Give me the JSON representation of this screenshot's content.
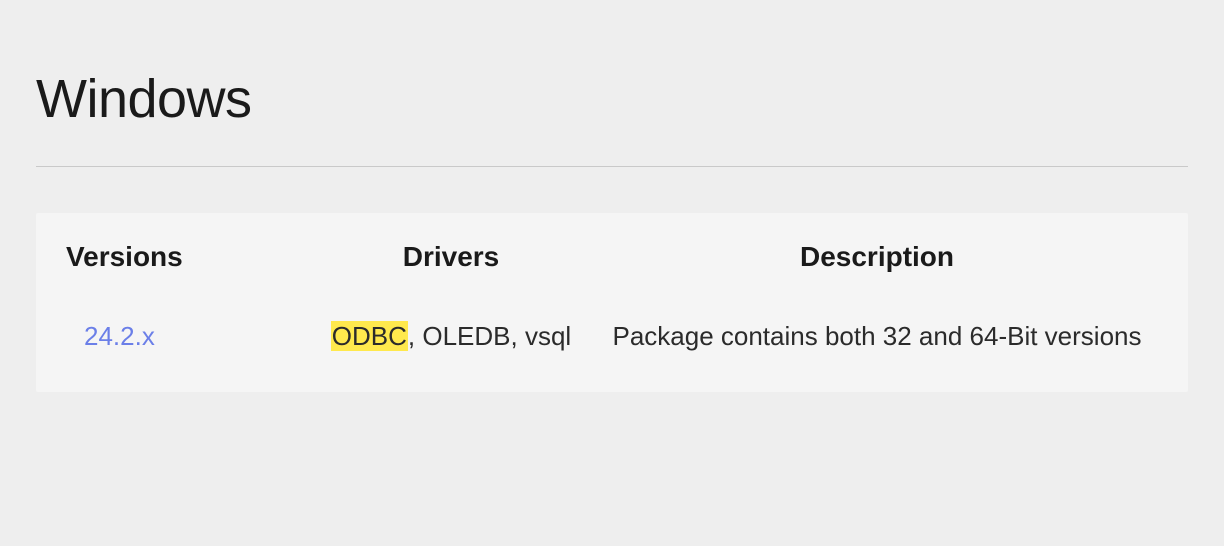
{
  "section": {
    "title": "Windows"
  },
  "table": {
    "headers": {
      "versions": "Versions",
      "drivers": "Drivers",
      "description": "Description"
    },
    "row": {
      "version": "24.2.x",
      "driver_highlight": "ODBC",
      "driver_rest": ", OLEDB, vsql",
      "description": "Package contains both 32 and 64-Bit versions"
    }
  }
}
